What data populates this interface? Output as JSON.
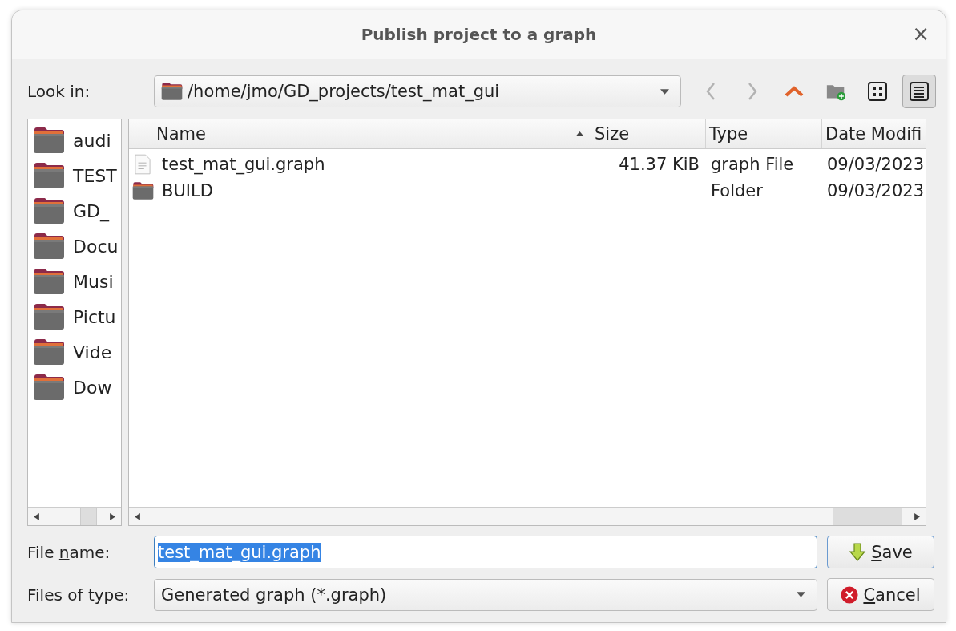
{
  "window": {
    "title": "Publish project to a graph",
    "close_label": "×"
  },
  "look_in": {
    "label": "Look in:",
    "path": "/home/jmo/GD_projects/test_mat_gui"
  },
  "toolbar": [
    {
      "kind": "back",
      "disabled": true,
      "selected": false
    },
    {
      "kind": "forward",
      "disabled": true,
      "selected": false
    },
    {
      "kind": "up",
      "disabled": false,
      "selected": false
    },
    {
      "kind": "new-folder",
      "disabled": false,
      "selected": false
    },
    {
      "kind": "icon-view",
      "disabled": false,
      "selected": false
    },
    {
      "kind": "detail-view",
      "disabled": false,
      "selected": true
    }
  ],
  "sidebar": {
    "items": [
      {
        "label": "audi"
      },
      {
        "label": "TEST"
      },
      {
        "label": "GD_"
      },
      {
        "label": "Docu"
      },
      {
        "label": "Musi"
      },
      {
        "label": "Pictu"
      },
      {
        "label": "Vide"
      },
      {
        "label": "Dow"
      }
    ]
  },
  "table": {
    "columns": [
      {
        "label": "Name",
        "sorted": true
      },
      {
        "label": "Size",
        "sorted": false
      },
      {
        "label": "Type",
        "sorted": false
      },
      {
        "label": "Date Modifi",
        "sorted": false
      }
    ],
    "rows": [
      {
        "kind": "file",
        "name": "test_mat_gui.graph",
        "size": "41.37 KiB",
        "type": "graph File",
        "date": "09/03/2023"
      },
      {
        "kind": "folder",
        "name": "BUILD",
        "type": "Folder",
        "date": "09/03/2023"
      }
    ]
  },
  "file_name": {
    "label_start": "File ",
    "label_key": "n",
    "label_rest": "ame:",
    "value": "test_mat_gui.graph",
    "text_selected": true
  },
  "file_type": {
    "label": "Files of type:",
    "value": "Generated graph (*.graph)"
  },
  "buttons": [
    {
      "kind": "save",
      "label_key": "S",
      "label_rest": "ave"
    },
    {
      "kind": "cancel",
      "label_key": "C",
      "label_rest": "ancel"
    }
  ]
}
